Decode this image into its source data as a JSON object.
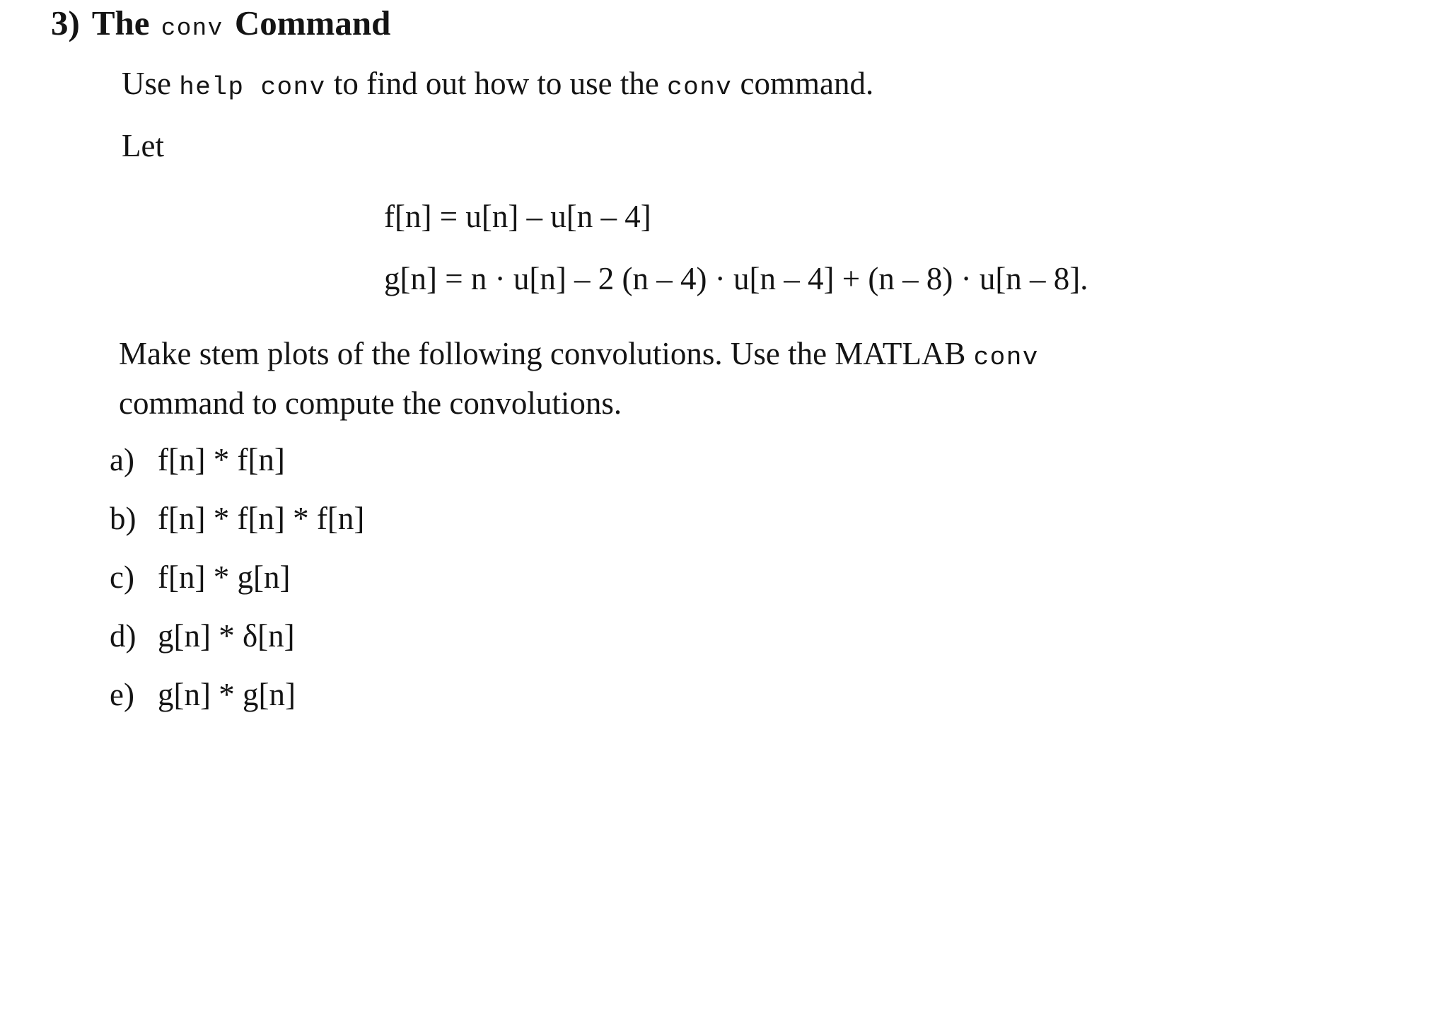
{
  "document": {
    "heading": {
      "marker": "3)",
      "text_before": "The ",
      "code": "conv",
      "text_after": " Command"
    },
    "paragraphs": {
      "use_line": {
        "before": "Use ",
        "code1": "help conv",
        "middle": " to find out how to use the ",
        "code2": "conv",
        "after": " command."
      },
      "let_line": "Let",
      "make_line_1_before": "Make stem plots of the following convolutions. Use the MATLAB ",
      "make_line_1_code": "conv",
      "make_line_2": "command to compute the convolutions."
    },
    "equations": {
      "f": "f[n] = u[n] – u[n – 4]",
      "g": "g[n] = n · u[n] – 2 (n – 4) · u[n – 4] + (n – 8) · u[n – 8]."
    },
    "list": [
      {
        "label": "a)",
        "expr": "f[n] * f[n]"
      },
      {
        "label": "b)",
        "expr": "f[n] * f[n] * f[n]"
      },
      {
        "label": "c)",
        "expr": "f[n] * g[n]"
      },
      {
        "label": "d)",
        "expr": "g[n] * δ[n]"
      },
      {
        "label": "e)",
        "expr": "g[n] * g[n]"
      }
    ],
    "colors": {
      "background": "#ffffff",
      "text": "#141414"
    }
  }
}
